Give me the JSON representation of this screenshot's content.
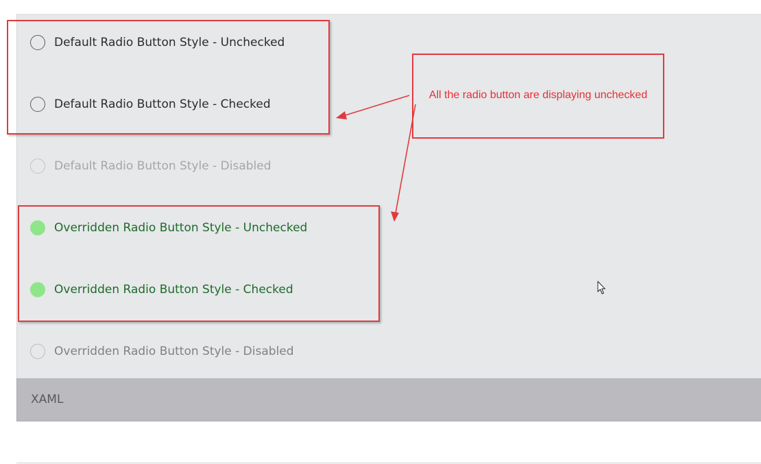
{
  "radio_buttons": [
    {
      "label": "Default Radio Button Style - Unchecked",
      "style": "default",
      "state": "unchecked"
    },
    {
      "label": "Default Radio Button Style - Checked",
      "style": "default",
      "state": "checked"
    },
    {
      "label": "Default Radio Button Style - Disabled",
      "style": "default",
      "state": "disabled"
    },
    {
      "label": "Overridden Radio Button Style - Unchecked",
      "style": "overridden",
      "state": "unchecked"
    },
    {
      "label": "Overridden Radio Button Style - Checked",
      "style": "overridden",
      "state": "checked"
    },
    {
      "label": "Overridden Radio Button Style - Disabled",
      "style": "overridden",
      "state": "disabled"
    }
  ],
  "xaml_section": {
    "label": "XAML"
  },
  "annotation": {
    "callout_text": "All the radio button are displaying unchecked"
  },
  "colors": {
    "annotation_red": "#e03a3e",
    "override_fill": "#8fe58a",
    "override_text": "#1e6b2a",
    "panel_background": "#e6e8ea",
    "xaml_bar": "#bbbabe"
  },
  "icons": {
    "radio": "radio-circle-icon",
    "cursor": "mouse-pointer-icon"
  }
}
